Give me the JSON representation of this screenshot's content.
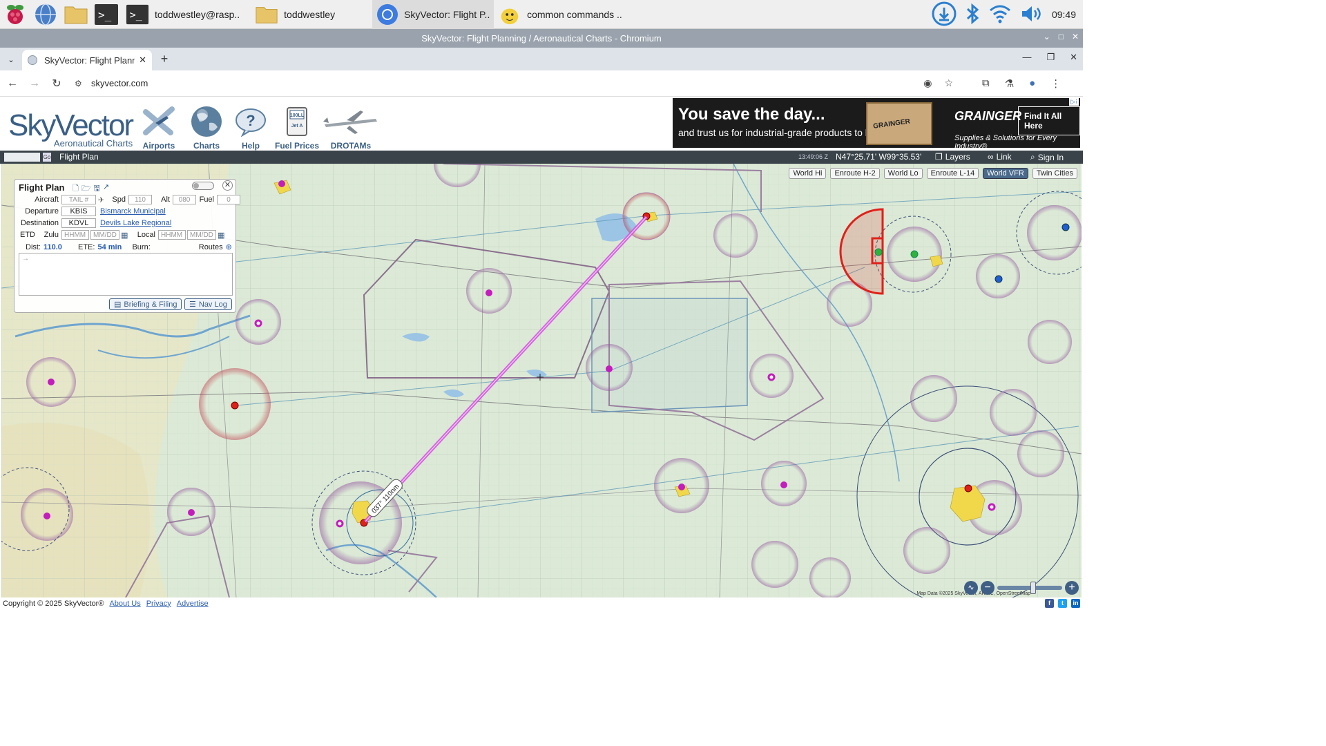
{
  "taskbar": {
    "tasks": [
      {
        "label": "toddwestley@rasp..",
        "icon": "terminal-icon"
      },
      {
        "label": "toddwestley",
        "icon": "folder-icon"
      },
      {
        "label": "SkyVector: Flight P..",
        "icon": "chromium-icon"
      },
      {
        "label": "common commands ..",
        "icon": "text-editor-icon"
      }
    ],
    "clock": "09:49"
  },
  "window": {
    "title": "SkyVector: Flight Planning / Aeronautical Charts - Chromium"
  },
  "browser": {
    "tab_title": "SkyVector: Flight Planning / Aeronautical Charts",
    "url": "skyvector.com"
  },
  "site": {
    "logo_text": "SkyVector",
    "logo_sub": "Aeronautical Charts",
    "nav": [
      {
        "label": "Airports",
        "icon": "airports-icon"
      },
      {
        "label": "Charts",
        "icon": "globe-icon"
      },
      {
        "label": "Help",
        "icon": "help-icon"
      },
      {
        "label": "Fuel Prices",
        "icon": "fuel-pump-icon"
      },
      {
        "label": "DROTAMs",
        "icon": "drone-icon"
      }
    ],
    "ad": {
      "headline": "You save the day...",
      "subline": "and trust us for industrial-grade products to help.",
      "brand": "GRAINGER",
      "cta": "Find It All Here",
      "tagline": "Supplies & Solutions for Every Industry®",
      "box_label": "GRAINGER"
    }
  },
  "map_toolbar": {
    "go_label": "Go",
    "flight_plan_label": "Flight Plan",
    "zulu_time": "13:49:06 Z",
    "coordinates": "N47°25.71' W99°35.53'",
    "layers_label": "Layers",
    "link_label": "Link",
    "sign_in_label": "Sign In"
  },
  "map": {
    "layer_buttons": [
      {
        "label": "World Hi",
        "active": false
      },
      {
        "label": "Enroute H-2",
        "active": false
      },
      {
        "label": "World Lo",
        "active": false
      },
      {
        "label": "Enroute L-14",
        "active": false
      },
      {
        "label": "World VFR",
        "active": true
      },
      {
        "label": "Twin Cities",
        "active": false
      }
    ],
    "route_label": "037° 110nm",
    "attribution": "Map Data ©2025 SkyVector, ARINC, OpenStreetMap"
  },
  "flight_plan": {
    "title": "Flight Plan",
    "aircraft_label": "Aircraft",
    "aircraft_placeholder": "TAIL #",
    "spd_label": "Spd",
    "spd_value": "110",
    "alt_label": "Alt",
    "alt_value": "080",
    "fuel_label": "Fuel",
    "fuel_value": "0",
    "departure_label": "Departure",
    "departure_code": "KBIS",
    "departure_name": "Bismarck Municipal",
    "destination_label": "Destination",
    "destination_code": "KDVL",
    "destination_name": "Devils Lake Regional",
    "etd_label": "ETD",
    "zulu_label": "Zulu",
    "local_label": "Local",
    "time_placeholder": "HHMM",
    "date_placeholder": "MM/DD",
    "dist_label": "Dist:",
    "dist_value": "110.0",
    "ete_label": "ETE:",
    "ete_value": "54 min",
    "burn_label": "Burn:",
    "routes_label": "Routes",
    "briefing_label": "Briefing & Filing",
    "navlog_label": "Nav Log"
  },
  "footer": {
    "copyright": "Copyright © 2025 SkyVector®",
    "links": [
      "About Us",
      "Privacy",
      "Advertise"
    ]
  },
  "colors": {
    "route_line": "#d24fe0",
    "airspace_red": "#e0201a",
    "toolbar": "#394349",
    "brand_blue": "#3a5f86"
  }
}
